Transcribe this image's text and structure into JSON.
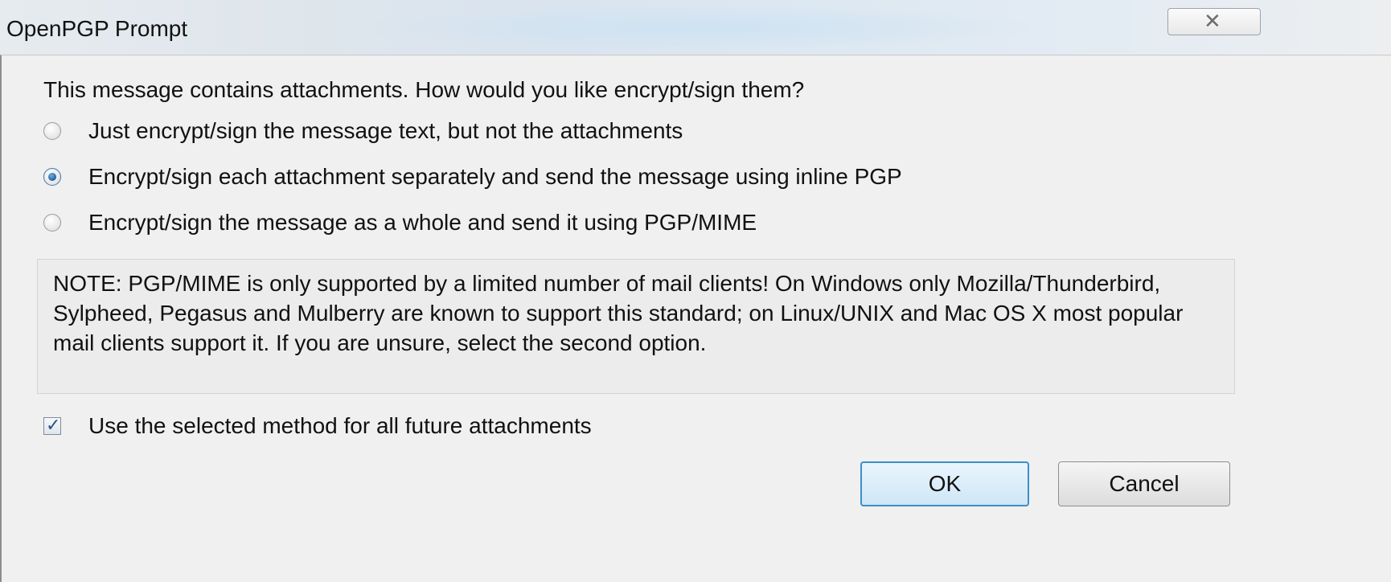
{
  "window": {
    "title": "OpenPGP Prompt",
    "close_icon": "close-icon"
  },
  "dialog": {
    "prompt": "This message contains attachments. How would you like encrypt/sign them?",
    "options": [
      {
        "label": "Just encrypt/sign the message text, but not the attachments",
        "checked": false
      },
      {
        "label": "Encrypt/sign each attachment separately and send the message using inline PGP",
        "checked": true
      },
      {
        "label": "Encrypt/sign the message as a whole and send it using PGP/MIME",
        "checked": false
      }
    ],
    "note": "NOTE: PGP/MIME is only supported by a limited number of mail clients! On Windows only Mozilla/Thunderbird, Sylpheed, Pegasus and Mulberry are known to support this standard; on Linux/UNIX and Mac OS X most popular mail clients support it. If you are unsure, select the second option.",
    "remember": {
      "label": "Use the selected method for all future attachments",
      "checked": true
    },
    "buttons": {
      "ok": "OK",
      "cancel": "Cancel"
    }
  },
  "colors": {
    "ok_border": "#3c8fc8",
    "radio_selected": "#1f5e9a"
  }
}
